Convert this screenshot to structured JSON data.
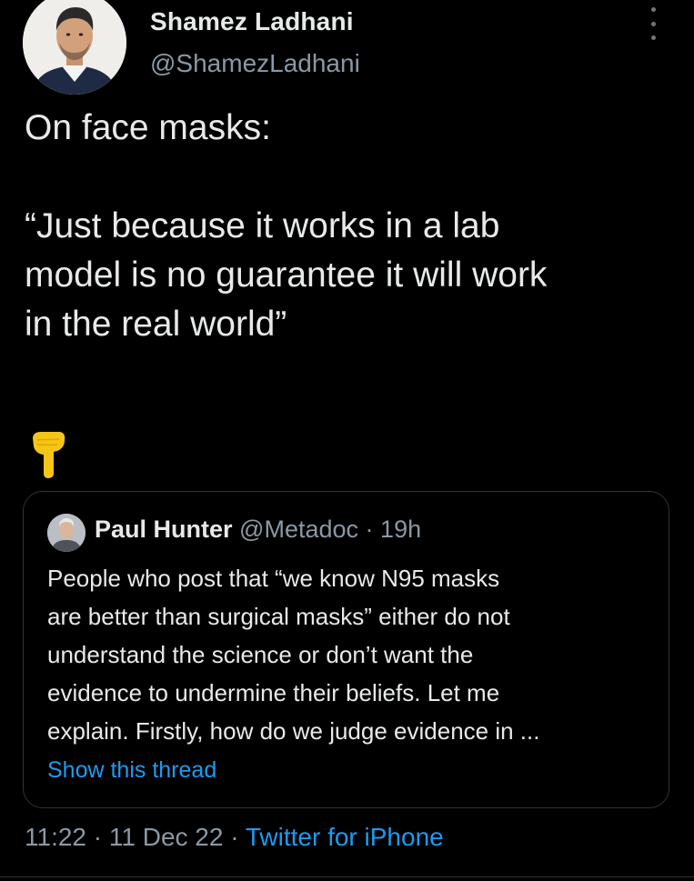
{
  "author": {
    "display_name": "Shamez Ladhani",
    "handle": "@ShamezLadhani",
    "avatar_icon": "profile-photo"
  },
  "more_icon": "vertical-ellipsis-icon",
  "tweet": {
    "lines": [
      "On face masks:",
      "“Just because it works in a lab",
      "model is no guarantee it will work",
      "in the real world”"
    ],
    "emoji": "pointing-down-emoji"
  },
  "quote": {
    "name": "Paul Hunter",
    "handle": "@Metadoc",
    "separator": "·",
    "time": "19h",
    "lines": [
      "People who post that “we know N95 masks",
      "are better than surgical masks” either do not",
      "understand the science or don’t want the",
      "evidence to undermine their beliefs. Let me",
      "explain. Firstly, how do we judge evidence in ..."
    ],
    "show_thread": "Show this thread"
  },
  "meta": {
    "time": "11:22",
    "sep1": "·",
    "date": "11 Dec 22",
    "sep2": "·",
    "source": "Twitter for iPhone"
  },
  "colors": {
    "background": "#000000",
    "text": "#e7e9ea",
    "secondary": "#8b98a5",
    "link": "#1d9bf0",
    "border": "#2f3336",
    "emoji": "#f5c518"
  }
}
